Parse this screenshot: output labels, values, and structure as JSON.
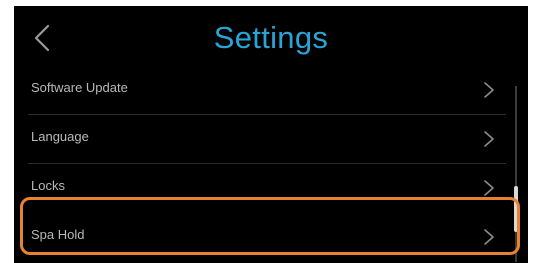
{
  "header": {
    "title": "Settings",
    "back_icon": "chevron-left-icon"
  },
  "settings": {
    "items": [
      {
        "label": "Software Update",
        "icon": "chevron-right-icon"
      },
      {
        "label": "Language",
        "icon": "chevron-right-icon"
      },
      {
        "label": "Locks",
        "icon": "chevron-right-icon"
      },
      {
        "label": "Spa Hold",
        "icon": "chevron-right-icon"
      }
    ],
    "highlighted_item": "Spa Hold"
  },
  "colors": {
    "background": "#000000",
    "title": "#2aa4d6",
    "item_text": "#b9b9b9",
    "highlight": "#e8822f",
    "scrollbar_thumb": "#d9d9d9"
  }
}
